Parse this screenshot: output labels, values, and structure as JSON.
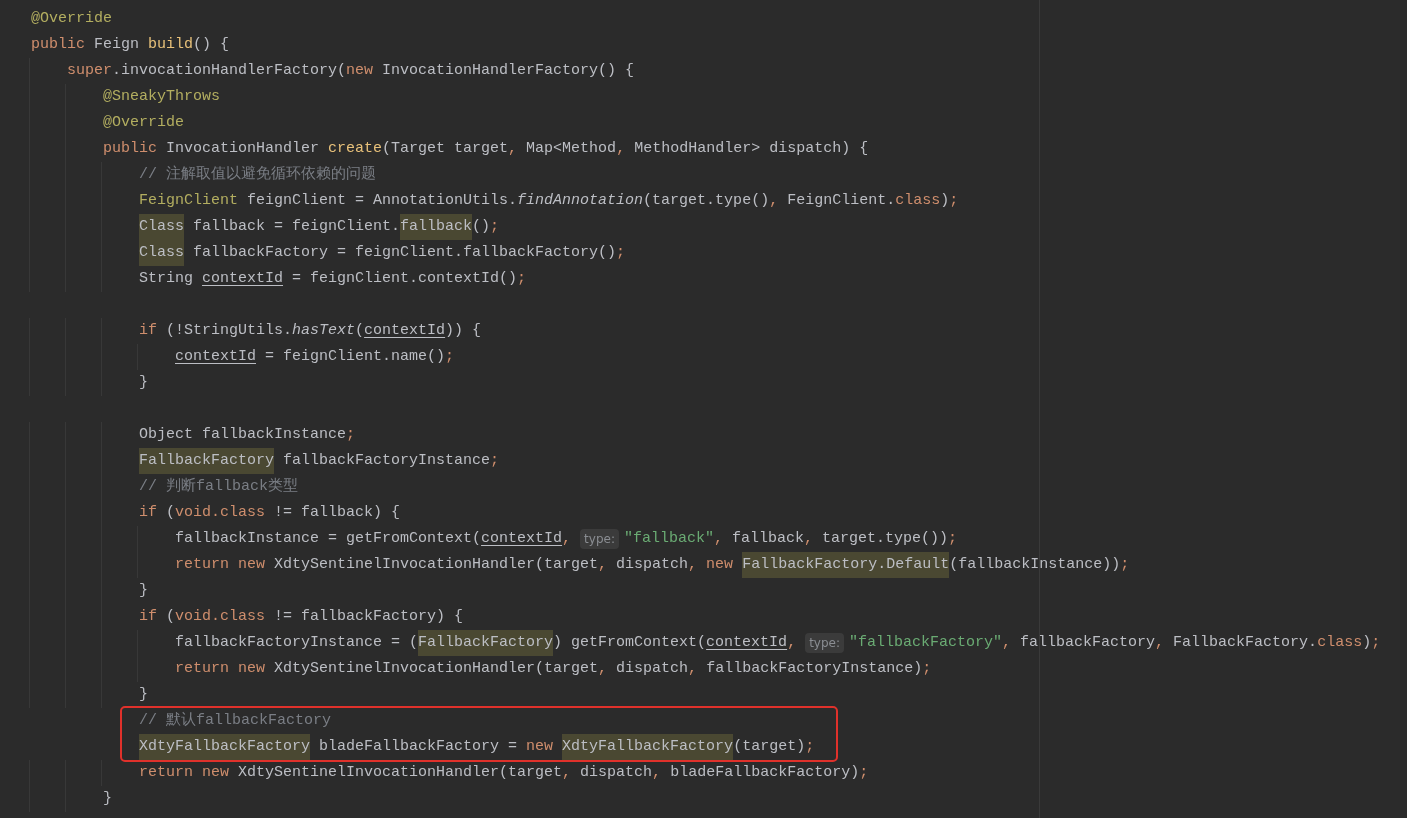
{
  "editor": {
    "lines": [
      {
        "boxed": false,
        "tokens": [
          {
            "t": "@Override",
            "kind": "ann"
          }
        ]
      },
      {
        "boxed": false,
        "tokens": [
          {
            "t": "public",
            "kind": "kw"
          },
          {
            "t": " Feign ",
            "kind": "plain"
          },
          {
            "t": "build",
            "kind": "fn"
          },
          {
            "t": "() {",
            "kind": "plain"
          }
        ]
      },
      {
        "boxed": false,
        "tokens": [
          {
            "t": "    super",
            "kind": "kw"
          },
          {
            "t": ".invocationHandlerFactory(",
            "kind": "plain"
          },
          {
            "t": "new",
            "kind": "kw"
          },
          {
            "t": " InvocationHandlerFactory() {",
            "kind": "plain"
          }
        ]
      },
      {
        "boxed": false,
        "tokens": [
          {
            "t": "        @SneakyThrows",
            "kind": "ann"
          }
        ]
      },
      {
        "boxed": false,
        "tokens": [
          {
            "t": "        @Override",
            "kind": "ann"
          }
        ]
      },
      {
        "boxed": false,
        "tokens": [
          {
            "t": "        public",
            "kind": "kw"
          },
          {
            "t": " InvocationHandler ",
            "kind": "plain"
          },
          {
            "t": "create",
            "kind": "fn"
          },
          {
            "t": "(Target target",
            "kind": "plain"
          },
          {
            "t": ",",
            "kind": "kw"
          },
          {
            "t": " Map<Method",
            "kind": "plain"
          },
          {
            "t": ",",
            "kind": "kw"
          },
          {
            "t": " MethodHandler> dispatch) {",
            "kind": "plain"
          }
        ]
      },
      {
        "boxed": false,
        "tokens": [
          {
            "t": "            // 注解取值以避免循环依赖的问题",
            "kind": "comment"
          }
        ]
      },
      {
        "boxed": false,
        "tokens": [
          {
            "t": "            FeignClient",
            "kind": "cls"
          },
          {
            "t": " feignClient = AnnotationUtils.",
            "kind": "plain"
          },
          {
            "t": "findAnnotation",
            "kind": "static"
          },
          {
            "t": "(target.type()",
            "kind": "plain"
          },
          {
            "t": ",",
            "kind": "kw"
          },
          {
            "t": " FeignClient.",
            "kind": "plain"
          },
          {
            "t": "class",
            "kind": "kw"
          },
          {
            "t": ")",
            "kind": "plain"
          },
          {
            "t": ";",
            "kind": "kw"
          }
        ]
      },
      {
        "boxed": false,
        "tokens": [
          {
            "t": "            Class",
            "kind": "hl"
          },
          {
            "t": " fallback = feignClient.",
            "kind": "plain"
          },
          {
            "t": "fallback",
            "kind": "hl"
          },
          {
            "t": "()",
            "kind": "plain"
          },
          {
            "t": ";",
            "kind": "kw"
          }
        ]
      },
      {
        "boxed": false,
        "tokens": [
          {
            "t": "            Class",
            "kind": "hl"
          },
          {
            "t": " fallbackFactory = feignClient.fallbackFactory()",
            "kind": "plain"
          },
          {
            "t": ";",
            "kind": "kw"
          }
        ]
      },
      {
        "boxed": false,
        "tokens": [
          {
            "t": "            String ",
            "kind": "plain"
          },
          {
            "t": "contextId",
            "kind": "var"
          },
          {
            "t": " = feignClient.contextId()",
            "kind": "plain"
          },
          {
            "t": ";",
            "kind": "kw"
          }
        ]
      },
      {
        "boxed": false
      },
      {
        "boxed": false,
        "tokens": [
          {
            "t": "            if",
            "kind": "kw"
          },
          {
            "t": " (!StringUtils.",
            "kind": "plain"
          },
          {
            "t": "hasText",
            "kind": "static"
          },
          {
            "t": "(",
            "kind": "plain"
          },
          {
            "t": "contextId",
            "kind": "var"
          },
          {
            "t": ")) {",
            "kind": "plain"
          }
        ]
      },
      {
        "boxed": false,
        "tokens": [
          {
            "t": "                contextId",
            "kind": "var"
          },
          {
            "t": " = feignClient.name()",
            "kind": "plain"
          },
          {
            "t": ";",
            "kind": "kw"
          }
        ]
      },
      {
        "boxed": false,
        "tokens": [
          {
            "t": "            }",
            "kind": "plain"
          }
        ]
      },
      {
        "boxed": false
      },
      {
        "boxed": false,
        "tokens": [
          {
            "t": "            Object fallbackInstance",
            "kind": "plain"
          },
          {
            "t": ";",
            "kind": "kw"
          }
        ]
      },
      {
        "boxed": false,
        "tokens": [
          {
            "t": "            FallbackFactory",
            "kind": "hl"
          },
          {
            "t": " fallbackFactoryInstance",
            "kind": "plain"
          },
          {
            "t": ";",
            "kind": "kw"
          }
        ]
      },
      {
        "boxed": false,
        "tokens": [
          {
            "t": "            // 判断fallback类型",
            "kind": "comment"
          }
        ]
      },
      {
        "boxed": false,
        "tokens": [
          {
            "t": "            if",
            "kind": "kw"
          },
          {
            "t": " (",
            "kind": "plain"
          },
          {
            "t": "void.class",
            "kind": "kw"
          },
          {
            "t": " != fallback) {",
            "kind": "plain"
          }
        ]
      },
      {
        "boxed": false,
        "tokens": [
          {
            "t": "                fallbackInstance = getFromContext(",
            "kind": "plain"
          },
          {
            "t": "contextId",
            "kind": "var"
          },
          {
            "t": ",",
            "kind": "kw"
          },
          {
            "t": "type:",
            "kind": "hint"
          },
          {
            "t": "\"fallback\"",
            "kind": "str"
          },
          {
            "t": ",",
            "kind": "kw"
          },
          {
            "t": " fallback",
            "kind": "plain"
          },
          {
            "t": ",",
            "kind": "kw"
          },
          {
            "t": " target.type())",
            "kind": "plain"
          },
          {
            "t": ";",
            "kind": "kw"
          }
        ]
      },
      {
        "boxed": false,
        "tokens": [
          {
            "t": "                return new",
            "kind": "kw"
          },
          {
            "t": " XdtySentinelInvocationHandler(target",
            "kind": "plain"
          },
          {
            "t": ",",
            "kind": "kw"
          },
          {
            "t": " dispatch",
            "kind": "plain"
          },
          {
            "t": ", new ",
            "kind": "kw"
          },
          {
            "t": "FallbackFactory.Default",
            "kind": "hl"
          },
          {
            "t": "(fallbackInstance))",
            "kind": "plain"
          },
          {
            "t": ";",
            "kind": "kw"
          }
        ]
      },
      {
        "boxed": false,
        "tokens": [
          {
            "t": "            }",
            "kind": "plain"
          }
        ]
      },
      {
        "boxed": false,
        "tokens": [
          {
            "t": "            if",
            "kind": "kw"
          },
          {
            "t": " (",
            "kind": "plain"
          },
          {
            "t": "void.class",
            "kind": "kw"
          },
          {
            "t": " != fallbackFactory) {",
            "kind": "plain"
          }
        ]
      },
      {
        "boxed": false,
        "tokens": [
          {
            "t": "                fallbackFactoryInstance = (",
            "kind": "plain"
          },
          {
            "t": "FallbackFactory",
            "kind": "hl"
          },
          {
            "t": ") getFromContext(",
            "kind": "plain"
          },
          {
            "t": "contextId",
            "kind": "var"
          },
          {
            "t": ",",
            "kind": "kw"
          },
          {
            "t": "type:",
            "kind": "hint"
          },
          {
            "t": "\"fallbackFactory\"",
            "kind": "str"
          },
          {
            "t": ",",
            "kind": "kw"
          },
          {
            "t": " fallbackFactory",
            "kind": "plain"
          },
          {
            "t": ",",
            "kind": "kw"
          },
          {
            "t": " FallbackFactory.",
            "kind": "plain"
          },
          {
            "t": "class",
            "kind": "kw"
          },
          {
            "t": ")",
            "kind": "plain"
          },
          {
            "t": ";",
            "kind": "kw"
          }
        ]
      },
      {
        "boxed": false,
        "tokens": [
          {
            "t": "                return new",
            "kind": "kw"
          },
          {
            "t": " XdtySentinelInvocationHandler(target",
            "kind": "plain"
          },
          {
            "t": ",",
            "kind": "kw"
          },
          {
            "t": " dispatch",
            "kind": "plain"
          },
          {
            "t": ",",
            "kind": "kw"
          },
          {
            "t": " fallbackFactoryInstance)",
            "kind": "plain"
          },
          {
            "t": ";",
            "kind": "kw"
          }
        ]
      },
      {
        "boxed": false,
        "tokens": [
          {
            "t": "            }",
            "kind": "plain"
          }
        ]
      },
      {
        "boxed": true,
        "tokens": [
          {
            "t": "            // 默认fallbackFactory",
            "kind": "comment"
          }
        ]
      },
      {
        "boxed": true,
        "tokens": [
          {
            "t": "            XdtyFallbackFactory",
            "kind": "hl"
          },
          {
            "t": " bladeFallbackFactory = ",
            "kind": "plain"
          },
          {
            "t": "new ",
            "kind": "kw"
          },
          {
            "t": "XdtyFallbackFactory",
            "kind": "hl"
          },
          {
            "t": "(target)",
            "kind": "plain"
          },
          {
            "t": ";",
            "kind": "kw"
          }
        ]
      },
      {
        "boxed": false,
        "tokens": [
          {
            "t": "            return new",
            "kind": "kw"
          },
          {
            "t": " XdtySentinelInvocationHandler(target",
            "kind": "plain"
          },
          {
            "t": ",",
            "kind": "kw"
          },
          {
            "t": " dispatch",
            "kind": "plain"
          },
          {
            "t": ",",
            "kind": "kw"
          },
          {
            "t": " bladeFallbackFactory)",
            "kind": "plain"
          },
          {
            "t": ";",
            "kind": "kw"
          }
        ]
      },
      {
        "boxed": false,
        "tokens": [
          {
            "t": "        }",
            "kind": "plain"
          }
        ]
      }
    ]
  }
}
